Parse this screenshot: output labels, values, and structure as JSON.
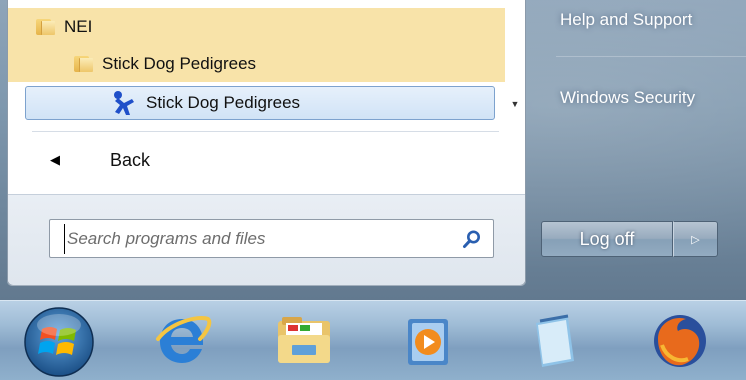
{
  "programs": {
    "folder_1": "NEI",
    "folder_2": "Stick Dog Pedigrees",
    "selected_item": "Stick Dog Pedigrees"
  },
  "back_label": "Back",
  "search": {
    "placeholder": "Search programs and files"
  },
  "right_pane": {
    "help_label": "Help and Support",
    "security_label": "Windows Security",
    "logoff_label": "Log off"
  },
  "taskbar": {
    "icons": [
      "start-orb-icon",
      "internet-explorer-icon",
      "file-explorer-icon",
      "media-player-icon",
      "notepad-icon",
      "firefox-icon"
    ]
  },
  "colors": {
    "folder_highlight": "#f8e3a9",
    "selection": "#d1e3f6",
    "glass": "#7f98ae"
  }
}
